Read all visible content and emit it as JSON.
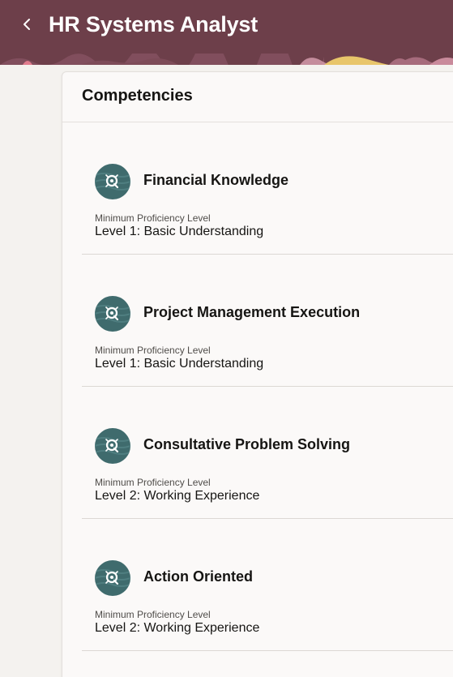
{
  "header": {
    "title": "HR Systems Analyst",
    "back_icon": "chevron-left-icon",
    "background_color": "#6d3f4a"
  },
  "competencies": {
    "title": "Competencies",
    "items": [
      {
        "name": "Financial Knowledge",
        "label": "Minimum Proficiency Level",
        "value": "Level 1: Basic Understanding",
        "icon": "competency-icon"
      },
      {
        "name": "Project Management Execution",
        "label": "Minimum Proficiency Level",
        "value": "Level 1: Basic Understanding",
        "icon": "competency-icon"
      },
      {
        "name": "Consultative Problem Solving",
        "label": "Minimum Proficiency Level",
        "value": "Level 2: Working Experience",
        "icon": "competency-icon"
      },
      {
        "name": "Action Oriented",
        "label": "Minimum Proficiency Level",
        "value": "Level 2: Working Experience",
        "icon": "competency-icon"
      }
    ]
  }
}
